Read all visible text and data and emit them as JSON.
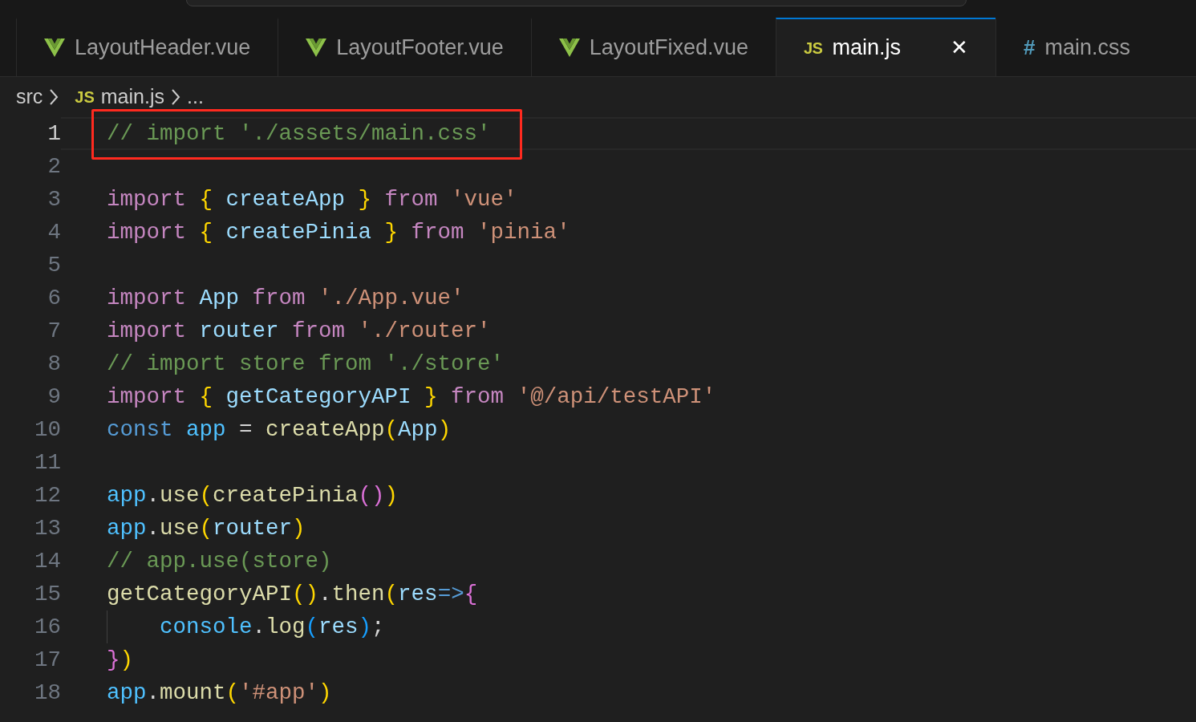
{
  "tabs": [
    {
      "label": "LayoutHeader.vue",
      "kind": "vue",
      "selected": false
    },
    {
      "label": "LayoutFooter.vue",
      "kind": "vue",
      "selected": false
    },
    {
      "label": "LayoutFixed.vue",
      "kind": "vue",
      "selected": false
    },
    {
      "label": "main.js",
      "kind": "js",
      "icon_text": "JS",
      "selected": true,
      "close": "✕"
    },
    {
      "label": "main.css",
      "kind": "css",
      "icon_text": "#",
      "selected": false
    }
  ],
  "breadcrumb": [
    {
      "label": "src"
    },
    {
      "label": "main.js",
      "icon_text": "JS"
    },
    {
      "label": "..."
    }
  ],
  "lines": [
    {
      "number": "1",
      "current": true,
      "annotated": true,
      "tokens": [
        {
          "kind": "comment",
          "text": "// import './assets/main.css'"
        }
      ]
    },
    {
      "number": "2",
      "current": false
    },
    {
      "number": "3",
      "current": false,
      "tokens": [
        {
          "kind": "keyword",
          "text": "import "
        },
        {
          "kind": "bracket-gold",
          "text": "{ "
        },
        {
          "kind": "variable",
          "text": "createApp"
        },
        {
          "kind": "bracket-gold",
          "text": " } "
        },
        {
          "kind": "keyword",
          "text": "from "
        },
        {
          "kind": "string",
          "text": "'vue'"
        }
      ]
    },
    {
      "number": "4",
      "current": false,
      "tokens": [
        {
          "kind": "keyword",
          "text": "import "
        },
        {
          "kind": "bracket-gold",
          "text": "{ "
        },
        {
          "kind": "variable",
          "text": "createPinia"
        },
        {
          "kind": "bracket-gold",
          "text": " } "
        },
        {
          "kind": "keyword",
          "text": "from "
        },
        {
          "kind": "string",
          "text": "'pinia'"
        }
      ]
    },
    {
      "number": "5",
      "current": false
    },
    {
      "number": "6",
      "current": false,
      "tokens": [
        {
          "kind": "keyword",
          "text": "import "
        },
        {
          "kind": "variable",
          "text": "App "
        },
        {
          "kind": "keyword",
          "text": "from "
        },
        {
          "kind": "string",
          "text": "'./App.vue'"
        }
      ]
    },
    {
      "number": "7",
      "current": false,
      "tokens": [
        {
          "kind": "keyword",
          "text": "import "
        },
        {
          "kind": "variable",
          "text": "router "
        },
        {
          "kind": "keyword",
          "text": "from "
        },
        {
          "kind": "string",
          "text": "'./router'"
        }
      ]
    },
    {
      "number": "8",
      "current": false,
      "tokens": [
        {
          "kind": "comment",
          "text": "// import store from './store'"
        }
      ]
    },
    {
      "number": "9",
      "current": false,
      "tokens": [
        {
          "kind": "keyword",
          "text": "import "
        },
        {
          "kind": "bracket-gold",
          "text": "{ "
        },
        {
          "kind": "variable",
          "text": "getCategoryAPI"
        },
        {
          "kind": "bracket-gold",
          "text": " } "
        },
        {
          "kind": "keyword",
          "text": "from "
        },
        {
          "kind": "string",
          "text": "'@/api/testAPI'"
        }
      ]
    },
    {
      "number": "10",
      "current": false,
      "tokens": [
        {
          "kind": "storage",
          "text": "const "
        },
        {
          "kind": "constant",
          "text": "app"
        },
        {
          "kind": "plain",
          "text": " = "
        },
        {
          "kind": "function",
          "text": "createApp"
        },
        {
          "kind": "bracket-gold",
          "text": "("
        },
        {
          "kind": "variable",
          "text": "App"
        },
        {
          "kind": "bracket-gold",
          "text": ")"
        }
      ]
    },
    {
      "number": "11",
      "current": false
    },
    {
      "number": "12",
      "current": false,
      "tokens": [
        {
          "kind": "constant",
          "text": "app"
        },
        {
          "kind": "plain",
          "text": "."
        },
        {
          "kind": "function",
          "text": "use"
        },
        {
          "kind": "bracket-gold",
          "text": "("
        },
        {
          "kind": "function",
          "text": "createPinia"
        },
        {
          "kind": "bracket-pink",
          "text": "()"
        },
        {
          "kind": "bracket-gold",
          "text": ")"
        }
      ]
    },
    {
      "number": "13",
      "current": false,
      "tokens": [
        {
          "kind": "constant",
          "text": "app"
        },
        {
          "kind": "plain",
          "text": "."
        },
        {
          "kind": "function",
          "text": "use"
        },
        {
          "kind": "bracket-gold",
          "text": "("
        },
        {
          "kind": "variable",
          "text": "router"
        },
        {
          "kind": "bracket-gold",
          "text": ")"
        }
      ]
    },
    {
      "number": "14",
      "current": false,
      "tokens": [
        {
          "kind": "comment",
          "text": "// app.use(store)"
        }
      ]
    },
    {
      "number": "15",
      "current": false,
      "tokens": [
        {
          "kind": "function",
          "text": "getCategoryAPI"
        },
        {
          "kind": "bracket-gold",
          "text": "()"
        },
        {
          "kind": "plain",
          "text": "."
        },
        {
          "kind": "function",
          "text": "then"
        },
        {
          "kind": "bracket-gold",
          "text": "("
        },
        {
          "kind": "variable",
          "text": "res"
        },
        {
          "kind": "storage",
          "text": "=>"
        },
        {
          "kind": "bracket-pink",
          "text": "{"
        }
      ]
    },
    {
      "number": "16",
      "current": false,
      "guide": true,
      "tokens": [
        {
          "kind": "constant",
          "text": "console"
        },
        {
          "kind": "plain",
          "text": "."
        },
        {
          "kind": "function",
          "text": "log"
        },
        {
          "kind": "bracket-blue",
          "text": "("
        },
        {
          "kind": "variable",
          "text": "res"
        },
        {
          "kind": "bracket-blue",
          "text": ")"
        },
        {
          "kind": "plain",
          "text": ";"
        }
      ]
    },
    {
      "number": "17",
      "current": false,
      "tokens": [
        {
          "kind": "bracket-pink",
          "text": "}"
        },
        {
          "kind": "bracket-gold",
          "text": ")"
        }
      ]
    },
    {
      "number": "18",
      "current": false,
      "tokens": [
        {
          "kind": "constant",
          "text": "app"
        },
        {
          "kind": "plain",
          "text": "."
        },
        {
          "kind": "function",
          "text": "mount"
        },
        {
          "kind": "bracket-gold",
          "text": "("
        },
        {
          "kind": "string",
          "text": "'#app'"
        },
        {
          "kind": "bracket-gold",
          "text": ")"
        }
      ]
    }
  ]
}
